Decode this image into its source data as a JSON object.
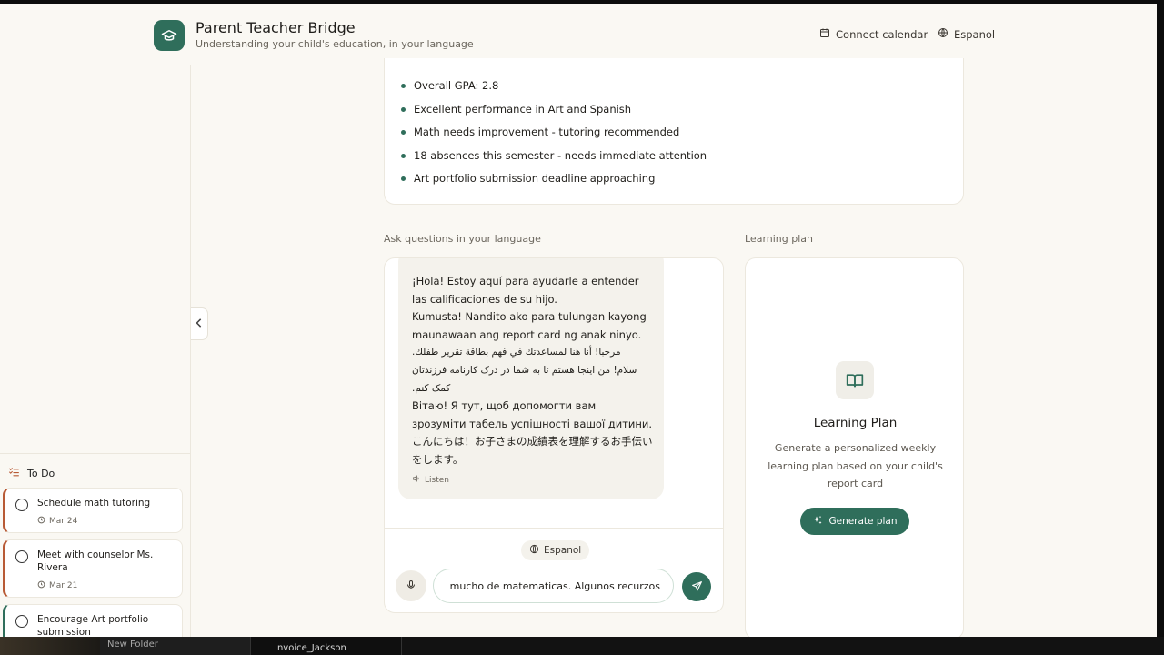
{
  "header": {
    "title": "Parent Teacher Bridge",
    "subtitle": "Understanding your child's education, in your language",
    "calendar_label": "Connect calendar",
    "language_label": "Espanol"
  },
  "summary": {
    "items": [
      "Overall GPA: 2.8",
      "Excellent performance in Art and Spanish",
      "Math needs improvement - tutoring recommended",
      "18 absences this semester - needs immediate attention",
      "Art portfolio submission deadline approaching"
    ]
  },
  "chat": {
    "section_label": "Ask questions in your language",
    "messages": [
      "¡Hola! Estoy aquí para ayudarle a entender las calificaciones de su hijo.",
      "Kumusta! Nandito ako para tulungan kayong maunawaan ang report card ng anak ninyo.",
      "مرحبا! أنا هنا لمساعدتك في فهم بطاقة تقرير طفلك.",
      "سلام! من اینجا هستم تا به شما در درک کارنامه فرزندتان کمک کنم.",
      "Вітаю! Я тут, щоб допомогти вам зрозуміти табель успішності вашої дитини.",
      "こんにちは！お子さまの成績表を理解するお手伝いをします。"
    ],
    "listen_label": "Listen",
    "language_label": "Espanol",
    "input_value": "Mi hijo necesita ayuda con mucho de matematicas. Algunos recurzos?"
  },
  "plan": {
    "section_label": "Learning plan",
    "title": "Learning Plan",
    "description": "Generate a personalized weekly learning plan based on your child's report card",
    "button_label": "Generate plan"
  },
  "todo": {
    "title": "To Do",
    "items": [
      {
        "title": "Schedule math tutoring",
        "date": "Mar 24"
      },
      {
        "title": "Meet with counselor Ms. Rivera",
        "date": "Mar 21"
      },
      {
        "title": "Encourage Art portfolio submission",
        "date": ""
      }
    ]
  },
  "taskbar": {
    "folder_label": "New Folder",
    "doc_label": "Invoice_Jackson"
  },
  "colors": {
    "accent": "#2f6e5b",
    "warning": "#b85a35",
    "background": "#faf8f3"
  }
}
